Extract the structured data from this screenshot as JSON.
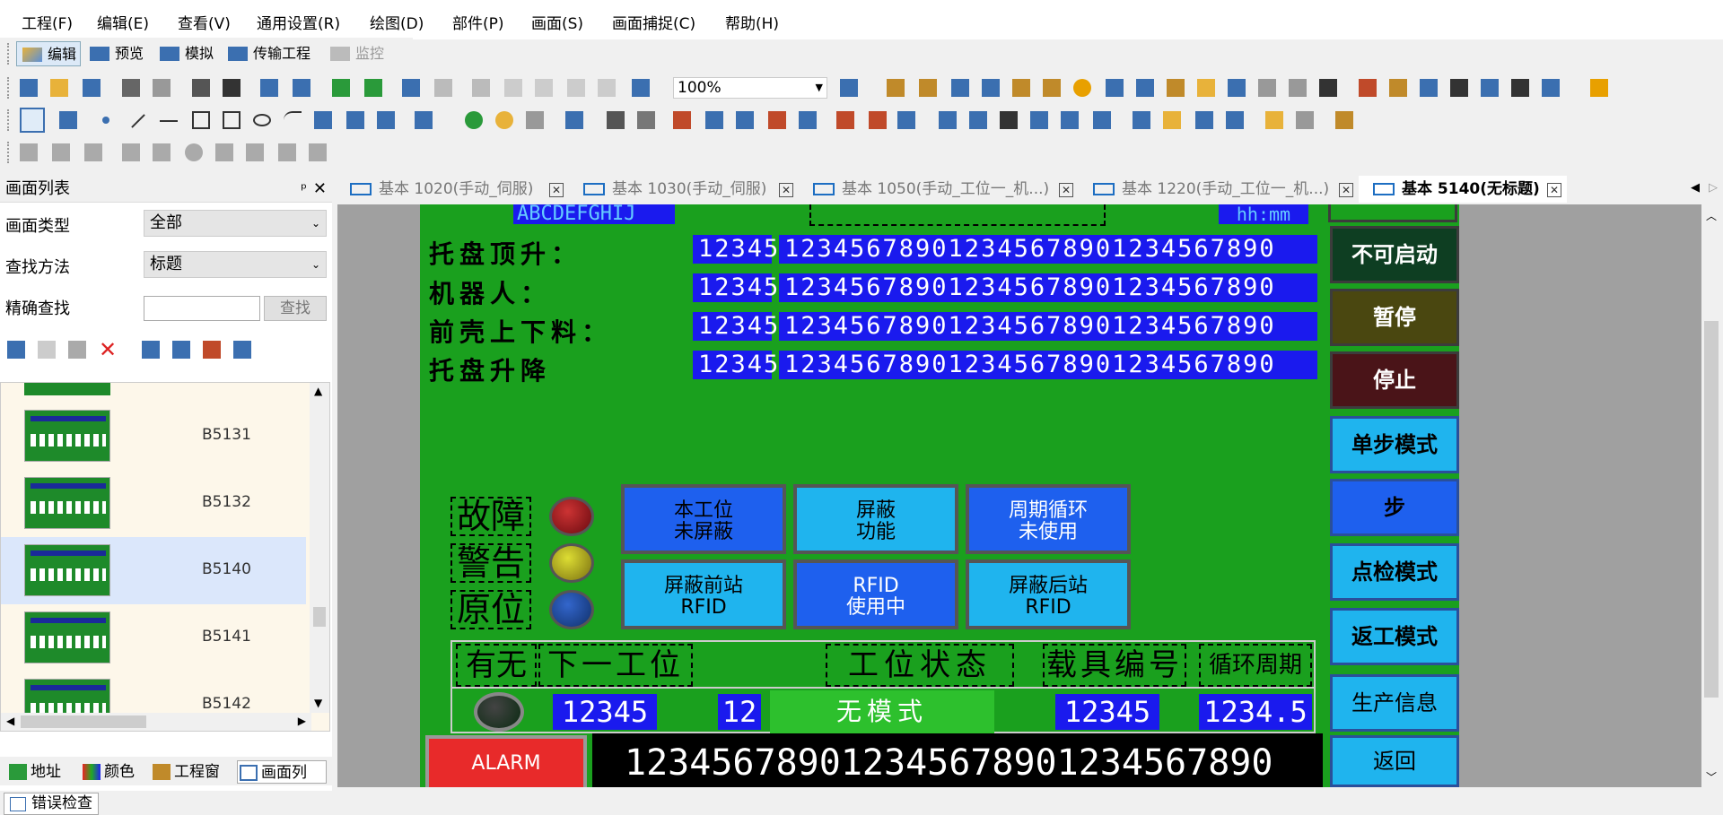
{
  "menu": [
    "工程(F)",
    "编辑(E)",
    "查看(V)",
    "通用设置(R)",
    "绘图(D)",
    "部件(P)",
    "画面(S)",
    "画面捕捉(C)",
    "帮助(H)"
  ],
  "modes": [
    "编辑",
    "预览",
    "模拟",
    "传输工程",
    "监控"
  ],
  "zoom": "100%",
  "left_panel": {
    "title": "画面列表",
    "pin": "ᵖ",
    "close": "✕",
    "type_label": "画面类型",
    "type_value": "全部",
    "method_label": "查找方法",
    "method_value": "标题",
    "exact_label": "精确查找",
    "find_button": "查找",
    "items": [
      "B5131",
      "B5132",
      "B5140",
      "B5141",
      "B5142"
    ],
    "tabs": [
      "地址",
      "颜色",
      "工程窗",
      "画面列"
    ]
  },
  "doc_tabs": [
    "基本 1020(手动_伺服)",
    "基本 1030(手动_伺服)",
    "基本 1050(手动_工位一_机...)",
    "基本 1220(手动_工位一_机...)",
    "基本 5140(无标题)"
  ],
  "screen": {
    "top_text": "ABCDEFGHIJ",
    "time_format": "hh:mm",
    "rows": [
      {
        "label": "托盘顶升：",
        "short": "12345",
        "long": "123456789012345678901234567890"
      },
      {
        "label": "机器人：",
        "short": "12345",
        "long": "123456789012345678901234567890"
      },
      {
        "label": "前壳上下料：",
        "short": "12345",
        "long": "123456789012345678901234567890"
      },
      {
        "label": "托盘升降",
        "short": "12345",
        "long": "123456789012345678901234567890"
      }
    ],
    "side_buttons": [
      "不可启动",
      "暂停",
      "停止",
      "单步模式",
      "步",
      "点检模式",
      "返工模式",
      "生产信息",
      "返回"
    ],
    "side_colors": [
      "#0e3e22",
      "#4a4710",
      "#4a1418",
      "#1fb4ee",
      "#1e60ee",
      "#1fb4ee",
      "#1fb4ee",
      "#1fb4ee",
      "#1fb4ee"
    ],
    "indicators": [
      "故障",
      "警告",
      "原位"
    ],
    "lamp_colors": [
      "#6a0a10",
      "#7a7010",
      "#10306a"
    ],
    "center_buttons": [
      {
        "line1": "本工位",
        "line2": "未屏蔽"
      },
      {
        "line1": "屏蔽",
        "line2": "功能"
      },
      {
        "line1": "周期循环",
        "line2": "未使用"
      },
      {
        "line1": "屏蔽前站",
        "line2": "RFID"
      },
      {
        "line1": "RFID",
        "line2": "使用中"
      },
      {
        "line1": "屏蔽后站",
        "line2": "RFID"
      }
    ],
    "table_headers": [
      "有无",
      "下一工位",
      "工位状态",
      "载具编号",
      "循环周期"
    ],
    "table_values": {
      "next": "12345",
      "small": "12",
      "mode": "无模式",
      "carrier": "12345",
      "cycle": "1234.5"
    },
    "alarm": "ALARM",
    "alarm_text": "123456789012345678901234567890"
  },
  "status": "错误检查"
}
